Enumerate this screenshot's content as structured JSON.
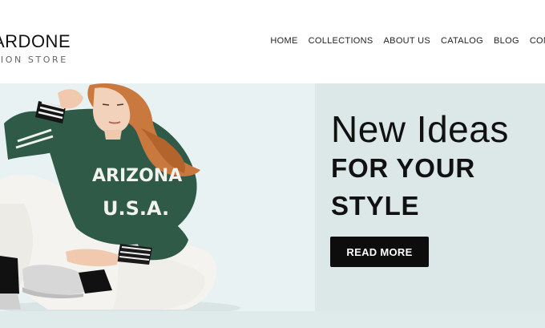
{
  "header": {
    "logo_name": "ARDONE",
    "logo_sub": "HION STORE"
  },
  "nav": {
    "items": [
      "HOME",
      "COLLECTIONS",
      "ABOUT US",
      "CATALOG",
      "BLOG",
      "CONTA"
    ]
  },
  "hero": {
    "headline_light": "New Ideas",
    "headline_bold_1": "FOR YOUR",
    "headline_bold_2": "STYLE",
    "button_label": "READ MORE",
    "sweater_text_1": "ARIZONA",
    "sweater_text_2": "U.S.A."
  },
  "colors": {
    "hero_bg": "#dce8e8",
    "photo_bg": "#e8f2f3",
    "button_bg": "#0d0d0d",
    "sweater": "#2f5a48"
  }
}
